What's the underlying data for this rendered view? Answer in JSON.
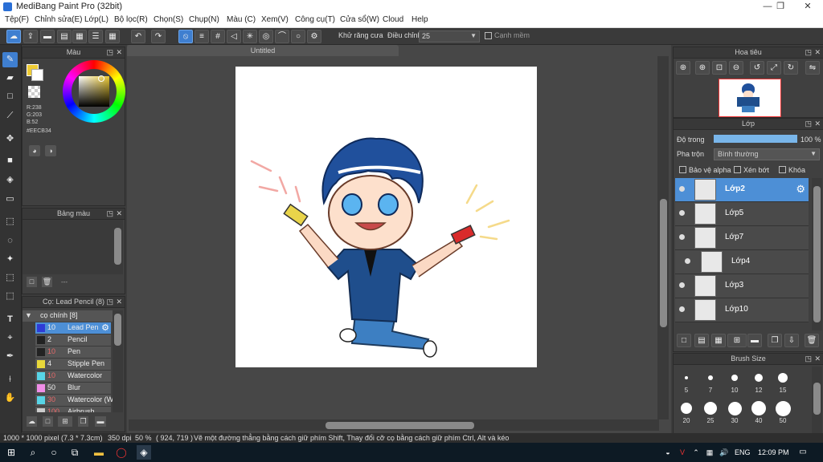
{
  "window": {
    "title": "MediBang Paint Pro (32bit)",
    "minimize": "—",
    "maximize": "❐",
    "close": "✕"
  },
  "menu": [
    "Tệp(F)",
    "Chỉnh sửa(E)",
    "Lớp(L)",
    "Bộ lọc(R)",
    "Chọn(S)",
    "Chụp(N)",
    "Màu (C)",
    "Xem(V)",
    "Công cụ(T)",
    "Cửa sổ(W)",
    "Cloud",
    "Help"
  ],
  "toolbar": {
    "antialias_label": "Khử răng cưa",
    "correction_label": "Điều chỉnh",
    "correction_value": "25",
    "smooth_label": "Cạnh mềm"
  },
  "color_panel": {
    "title": "Màu",
    "r": "R:238",
    "g": "G:203",
    "b": "B:52",
    "hex": "#EECB34",
    "fg_color": "#EECB34"
  },
  "palette_panel": {
    "title": "Bảng màu",
    "footer": "---"
  },
  "brush_panel": {
    "title": "Cọ: Lead Pencil (8)",
    "group": "cọ chính [8]",
    "items": [
      {
        "size": "10",
        "name": "Lead Pen",
        "color": "#2f3bd6"
      },
      {
        "size": "2",
        "name": "Pencil",
        "color": "#222222"
      },
      {
        "size": "10",
        "name": "Pen",
        "color": "#222222"
      },
      {
        "size": "4",
        "name": "Stipple Pen",
        "color": "#e8d83a"
      },
      {
        "size": "10",
        "name": "Watercolor",
        "color": "#58d4e6"
      },
      {
        "size": "50",
        "name": "Blur",
        "color": "#f08ee8"
      },
      {
        "size": "30",
        "name": "Watercolor (W",
        "color": "#58d4e6"
      },
      {
        "size": "100",
        "name": "Airbrush",
        "color": "#cccccc"
      }
    ]
  },
  "document": {
    "tab": "Untitled"
  },
  "navigator": {
    "title": "Hoa tiêu"
  },
  "layer_panel": {
    "title": "Lớp",
    "opacity_label": "Độ trong",
    "opacity_value": "100 %",
    "opacity": 100,
    "blend_label": "Pha trộn",
    "blend_value": "Bình thường",
    "protect_alpha": "Bảo vệ alpha",
    "clipping": "Xén bớt",
    "lock": "Khóa",
    "layers": [
      "Lớp2",
      "Lớp5",
      "Lớp7",
      "Lớp4",
      "Lớp3",
      "Lớp10"
    ]
  },
  "brush_size_panel": {
    "title": "Brush Size",
    "sizes_row1": [
      "5",
      "7",
      "10",
      "12",
      "15"
    ],
    "sizes_row2": [
      "20",
      "25",
      "30",
      "40",
      "50"
    ]
  },
  "status": {
    "dims": "1000 * 1000 pixel",
    "cm": "(7.3 * 7.3cm)",
    "dpi": "350 dpi",
    "zoom": "50 %",
    "coords": "( 924, 719 )",
    "hint": "Vẽ một đường thẳng bằng cách giữ phím Shift, Thay đổi cỡ cọ bằng cách giữ phím Ctrl, Alt và kéo"
  },
  "taskbar": {
    "lang": "ENG",
    "time": "12:09 PM"
  }
}
